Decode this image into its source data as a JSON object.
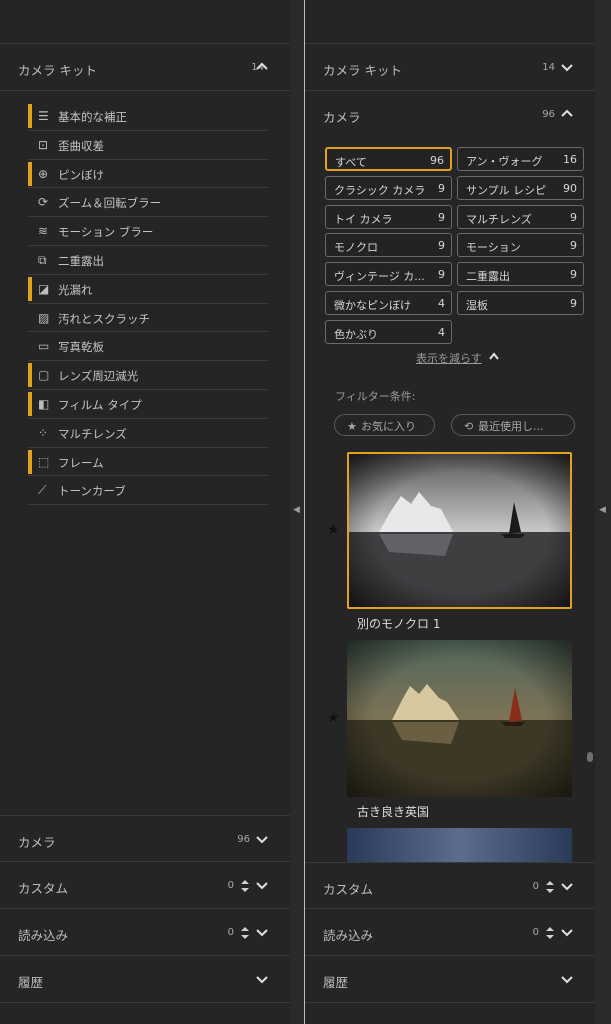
{
  "left": {
    "camera_kit": {
      "title": "カメラ キット",
      "count": "14"
    },
    "modules": [
      {
        "label": "基本的な補正",
        "active": true,
        "icon": "sliders-icon"
      },
      {
        "label": "歪曲収差",
        "active": false,
        "icon": "distortion-icon"
      },
      {
        "label": "ピンぼけ",
        "active": true,
        "icon": "focus-icon"
      },
      {
        "label": "ズーム＆回転ブラー",
        "active": false,
        "icon": "rotate-icon"
      },
      {
        "label": "モーション ブラー",
        "active": false,
        "icon": "motion-icon"
      },
      {
        "label": "二重露出",
        "active": false,
        "icon": "double-exposure-icon"
      },
      {
        "label": "光漏れ",
        "active": true,
        "icon": "light-leak-icon"
      },
      {
        "label": "汚れとスクラッチ",
        "active": false,
        "icon": "scratch-icon"
      },
      {
        "label": "写真乾板",
        "active": false,
        "icon": "plate-icon"
      },
      {
        "label": "レンズ周辺減光",
        "active": true,
        "icon": "vignette-icon"
      },
      {
        "label": "フィルム タイプ",
        "active": true,
        "icon": "film-icon"
      },
      {
        "label": "マルチレンズ",
        "active": false,
        "icon": "multilens-icon"
      },
      {
        "label": "フレーム",
        "active": true,
        "icon": "frame-icon"
      },
      {
        "label": "トーンカーブ",
        "active": false,
        "icon": "curve-icon"
      }
    ],
    "camera": {
      "title": "カメラ",
      "count": "96"
    },
    "custom": {
      "title": "カスタム",
      "count": "0"
    },
    "import": {
      "title": "読み込み",
      "count": "0"
    },
    "history": {
      "title": "履歴"
    }
  },
  "right": {
    "camera_kit": {
      "title": "カメラ キット",
      "count": "14"
    },
    "camera": {
      "title": "カメラ",
      "count": "96"
    },
    "filters": [
      {
        "label": "すべて",
        "count": "96",
        "active": true
      },
      {
        "label": "アン・ヴォーグ",
        "count": "16",
        "active": false
      },
      {
        "label": "クラシック カメラ",
        "count": "9",
        "active": false
      },
      {
        "label": "サンプル レシピ",
        "count": "90",
        "active": false
      },
      {
        "label": "トイ カメラ",
        "count": "9",
        "active": false
      },
      {
        "label": "マルチレンズ",
        "count": "9",
        "active": false
      },
      {
        "label": "モノクロ",
        "count": "9",
        "active": false
      },
      {
        "label": "モーション",
        "count": "9",
        "active": false
      },
      {
        "label": "ヴィンテージ カ...",
        "count": "9",
        "active": false
      },
      {
        "label": "二重露出",
        "count": "9",
        "active": false
      },
      {
        "label": "微かなピンぼけ",
        "count": "4",
        "active": false
      },
      {
        "label": "湿板",
        "count": "9",
        "active": false
      },
      {
        "label": "色かぶり",
        "count": "4",
        "active": false
      }
    ],
    "show_less": "表示を減らす",
    "filter_condition": "フィルター条件:",
    "favorites": "お気に入り",
    "recent": "最近使用し...",
    "presets": [
      {
        "name": "別のモノクロ 1"
      },
      {
        "name": "古き良き英国"
      }
    ],
    "custom": {
      "title": "カスタム",
      "count": "0"
    },
    "import": {
      "title": "読み込み",
      "count": "0"
    },
    "history": {
      "title": "履歴"
    }
  },
  "colors": {
    "accent": "#e2a21e",
    "panel": "#252525",
    "divider": "#3a3a3a"
  }
}
